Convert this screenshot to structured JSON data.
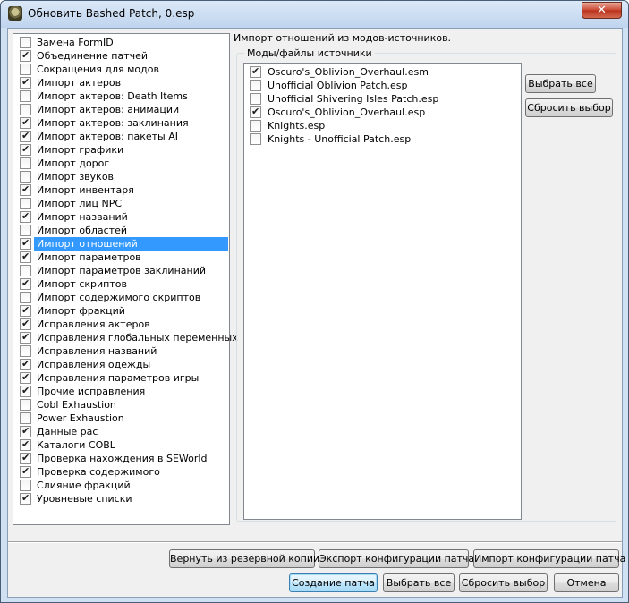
{
  "window": {
    "title": "Обновить Bashed Patch, 0.esp",
    "close_glyph": "✕"
  },
  "patchers": [
    {
      "label": "Замена FormID",
      "checked": false
    },
    {
      "label": "Объединение патчей",
      "checked": true
    },
    {
      "label": "Сокращения для модов",
      "checked": false
    },
    {
      "label": "Импорт актеров",
      "checked": true
    },
    {
      "label": "Импорт актеров: Death Items",
      "checked": false
    },
    {
      "label": "Импорт актеров: анимации",
      "checked": false
    },
    {
      "label": "Импорт актеров: заклинания",
      "checked": true
    },
    {
      "label": "Импорт актеров: пакеты AI",
      "checked": true
    },
    {
      "label": "Импорт графики",
      "checked": true
    },
    {
      "label": "Импорт дорог",
      "checked": false
    },
    {
      "label": "Импорт звуков",
      "checked": false
    },
    {
      "label": "Импорт инвентаря",
      "checked": true
    },
    {
      "label": "Импорт лиц NPC",
      "checked": false
    },
    {
      "label": "Импорт названий",
      "checked": true
    },
    {
      "label": "Импорт областей",
      "checked": false
    },
    {
      "label": "Импорт отношений",
      "checked": true,
      "selected": true
    },
    {
      "label": "Импорт параметров",
      "checked": true
    },
    {
      "label": "Импорт параметров заклинаний",
      "checked": false
    },
    {
      "label": "Импорт скриптов",
      "checked": true
    },
    {
      "label": "Импорт содержимого скриптов",
      "checked": false
    },
    {
      "label": "Импорт фракций",
      "checked": true
    },
    {
      "label": "Исправления актеров",
      "checked": true
    },
    {
      "label": "Исправления глобальных переменных",
      "checked": true
    },
    {
      "label": "Исправления названий",
      "checked": false
    },
    {
      "label": "Исправления одежды",
      "checked": true
    },
    {
      "label": "Исправления параметров игры",
      "checked": true
    },
    {
      "label": "Прочие исправления",
      "checked": true
    },
    {
      "label": "Cobl Exhaustion",
      "checked": false
    },
    {
      "label": "Power Exhaustion",
      "checked": false
    },
    {
      "label": "Данные рас",
      "checked": true
    },
    {
      "label": "Каталоги COBL",
      "checked": true
    },
    {
      "label": "Проверка нахождения в SEWorld",
      "checked": true
    },
    {
      "label": "Проверка содержимого",
      "checked": true
    },
    {
      "label": "Слияние фракций",
      "checked": false
    },
    {
      "label": "Уровневые списки",
      "checked": true
    }
  ],
  "details": {
    "description": "Импорт отношений из модов-источников.",
    "group_label": "Моды/файлы источники",
    "sources": [
      {
        "label": "Oscuro's_Oblivion_Overhaul.esm",
        "checked": true
      },
      {
        "label": "Unofficial Oblivion Patch.esp",
        "checked": false
      },
      {
        "label": "Unofficial Shivering Isles Patch.esp",
        "checked": false
      },
      {
        "label": "Oscuro's_Oblivion_Overhaul.esp",
        "checked": true
      },
      {
        "label": "Knights.esp",
        "checked": false
      },
      {
        "label": "Knights - Unofficial Patch.esp",
        "checked": false
      }
    ],
    "select_all_label": "Выбрать все",
    "deselect_label": "Сбросить выбор"
  },
  "footer": {
    "restore_backup_label": "Вернуть из резервной копии",
    "export_config_label": "Экспорт конфигурации патча",
    "import_config_label": "Импорт конфигурации патча",
    "build_patch_label": "Создание патча",
    "select_all_label": "Выбрать все",
    "deselect_label": "Сбросить выбор",
    "cancel_label": "Отмена"
  }
}
